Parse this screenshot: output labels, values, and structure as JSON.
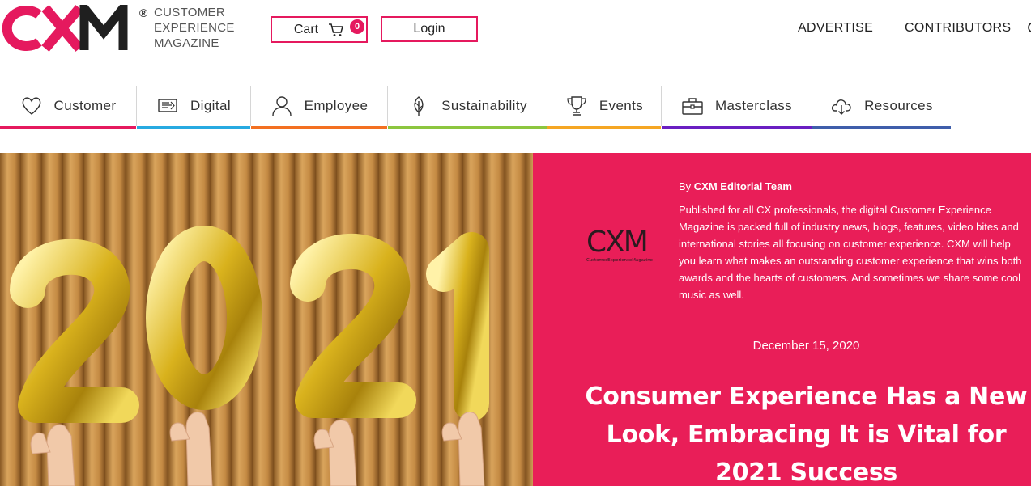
{
  "brand": {
    "logo_text": "CXM",
    "registered": "®",
    "tagline_lines": [
      "CUSTOMER",
      "EXPERIENCE",
      "MAGAZINE"
    ],
    "accent_color": "#e5195e",
    "dark_color": "#1f1f1f"
  },
  "header": {
    "cart_label": "Cart",
    "cart_count": "0",
    "login_label": "Login",
    "links": [
      "ADVERTISE",
      "CONTRIBUTORS"
    ]
  },
  "nav": {
    "items": [
      {
        "label": "Customer",
        "icon": "heart-icon",
        "color": "#e5195e"
      },
      {
        "label": "Digital",
        "icon": "digital-icon",
        "color": "#27aae1"
      },
      {
        "label": "Employee",
        "icon": "person-icon",
        "color": "#f37021"
      },
      {
        "label": "Sustainability",
        "icon": "leaf-icon",
        "color": "#8cc63f"
      },
      {
        "label": "Events",
        "icon": "trophy-icon",
        "color": "#f5a623"
      },
      {
        "label": "Masterclass",
        "icon": "briefcase-icon",
        "color": "#6a1fc2"
      },
      {
        "label": "Resources",
        "icon": "cloud-download-icon",
        "color": "#3f5eab"
      }
    ]
  },
  "hero": {
    "image_caption": "2021",
    "panel_color": "#e91e58",
    "author_logo_text": "CXM",
    "author_logo_sub": "CustomerExperienceMagazine",
    "by_prefix": "By",
    "author": "CXM Editorial Team",
    "bio": "Published for all CX professionals, the digital Customer Experience Magazine is packed full of industry news, blogs, features, video bites and international stories all focusing on customer experience. CXM will help you learn what makes an outstanding customer experience that wins both awards and the hearts of customers. And sometimes we share some cool music as well.",
    "date": "December 15, 2020",
    "title": "Consumer Experience Has a New Look, Embracing It is Vital for 2021 Success"
  }
}
